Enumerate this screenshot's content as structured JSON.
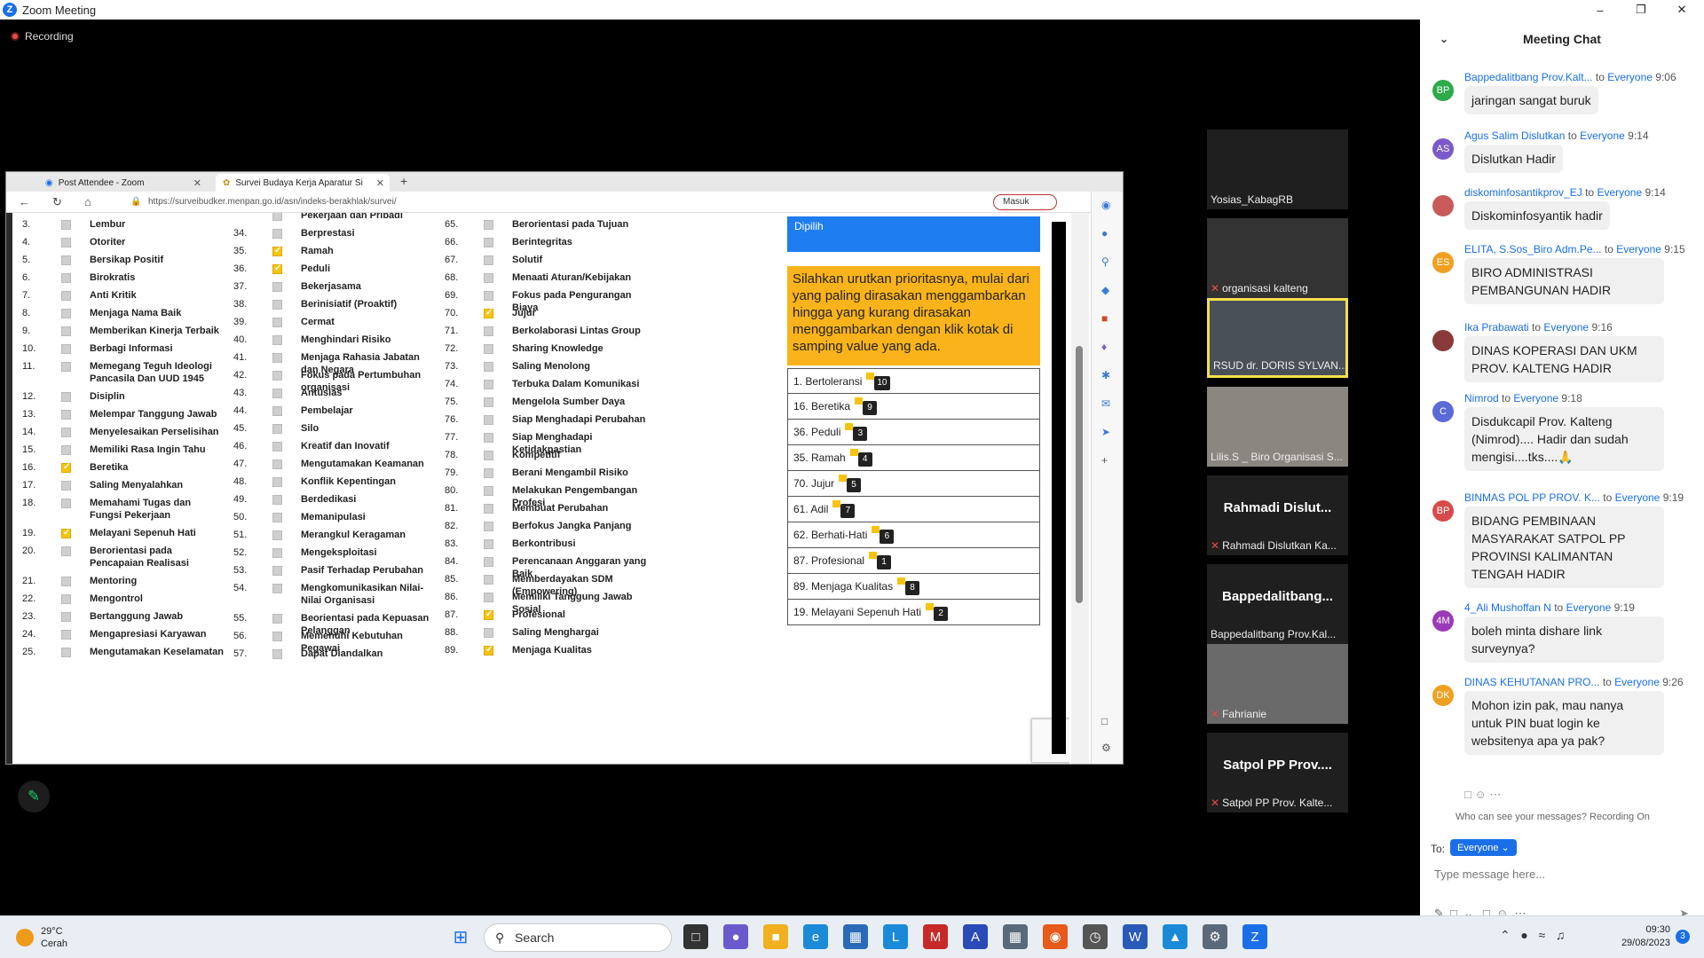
{
  "window": {
    "title": "Zoom Meeting"
  },
  "recording": "Recording",
  "browser": {
    "tabs": [
      {
        "label": "Post Attendee - Zoom"
      },
      {
        "label": "Survei Budaya Kerja Aparatur Si"
      }
    ],
    "url": "https://surveibudker.menpan.go.id/asn/indeks-berakhlak/survei/",
    "masuk": "Masuk"
  },
  "survey": {
    "col1": [
      {
        "n": "3.",
        "label": "Lembur",
        "checked": false
      },
      {
        "n": "4.",
        "label": "Otoriter",
        "checked": false
      },
      {
        "n": "5.",
        "label": "Bersikap Positif",
        "checked": false
      },
      {
        "n": "6.",
        "label": "Birokratis",
        "checked": false
      },
      {
        "n": "7.",
        "label": "Anti Kritik",
        "checked": false
      },
      {
        "n": "8.",
        "label": "Menjaga Nama Baik",
        "checked": false
      },
      {
        "n": "9.",
        "label": "Memberikan Kinerja Terbaik",
        "checked": false
      },
      {
        "n": "10.",
        "label": "Berbagi Informasi",
        "checked": false
      },
      {
        "n": "11.",
        "label": "Memegang Teguh Ideologi Pancasila Dan UUD 1945",
        "checked": false
      },
      {
        "n": "12.",
        "label": "Disiplin",
        "checked": false
      },
      {
        "n": "13.",
        "label": "Melempar Tanggung Jawab",
        "checked": false
      },
      {
        "n": "14.",
        "label": "Menyelesaikan Perselisihan",
        "checked": false
      },
      {
        "n": "15.",
        "label": "Memiliki Rasa Ingin Tahu",
        "checked": false
      },
      {
        "n": "16.",
        "label": "Beretika",
        "checked": true
      },
      {
        "n": "17.",
        "label": "Saling Menyalahkan",
        "checked": false
      },
      {
        "n": "18.",
        "label": "Memahami Tugas dan Fungsi Pekerjaan",
        "checked": false
      },
      {
        "n": "19.",
        "label": "Melayani Sepenuh Hati",
        "checked": true
      },
      {
        "n": "20.",
        "label": "Berorientasi pada Pencapaian Realisasi",
        "checked": false
      },
      {
        "n": "21.",
        "label": "Mentoring",
        "checked": false
      },
      {
        "n": "22.",
        "label": "Mengontrol",
        "checked": false
      },
      {
        "n": "23.",
        "label": "Bertanggung Jawab",
        "checked": false
      },
      {
        "n": "24.",
        "label": "Mengapresiasi Karyawan",
        "checked": false
      },
      {
        "n": "25.",
        "label": "Mengutamakan Keselamatan",
        "checked": false
      }
    ],
    "col2": [
      {
        "n": "",
        "label": "Pekerjaan dan Pribadi",
        "checked": false
      },
      {
        "n": "34.",
        "label": "Berprestasi",
        "checked": false
      },
      {
        "n": "35.",
        "label": "Ramah",
        "checked": true
      },
      {
        "n": "36.",
        "label": "Peduli",
        "checked": true
      },
      {
        "n": "37.",
        "label": "Bekerjasama",
        "checked": false
      },
      {
        "n": "38.",
        "label": "Berinisiatif (Proaktif)",
        "checked": false
      },
      {
        "n": "39.",
        "label": "Cermat",
        "checked": false
      },
      {
        "n": "40.",
        "label": "Menghindari Risiko",
        "checked": false
      },
      {
        "n": "41.",
        "label": "Menjaga Rahasia Jabatan dan Negara",
        "checked": false
      },
      {
        "n": "42.",
        "label": "Fokus pada Pertumbuhan organisasi",
        "checked": false
      },
      {
        "n": "43.",
        "label": "Antusias",
        "checked": false
      },
      {
        "n": "44.",
        "label": "Pembelajar",
        "checked": false
      },
      {
        "n": "45.",
        "label": "Silo",
        "checked": false
      },
      {
        "n": "46.",
        "label": "Kreatif dan Inovatif",
        "checked": false
      },
      {
        "n": "47.",
        "label": "Mengutamakan Keamanan",
        "checked": false
      },
      {
        "n": "48.",
        "label": "Konflik Kepentingan",
        "checked": false
      },
      {
        "n": "49.",
        "label": "Berdedikasi",
        "checked": false
      },
      {
        "n": "50.",
        "label": "Memanipulasi",
        "checked": false
      },
      {
        "n": "51.",
        "label": "Merangkul Keragaman",
        "checked": false
      },
      {
        "n": "52.",
        "label": "Mengeksploitasi",
        "checked": false
      },
      {
        "n": "53.",
        "label": "Pasif Terhadap Perubahan",
        "checked": false
      },
      {
        "n": "54.",
        "label": "Mengkomunikasikan Nilai-Nilai Organisasi",
        "checked": false
      },
      {
        "n": "55.",
        "label": "Beorientasi pada Kepuasan Pelanggan",
        "checked": false
      },
      {
        "n": "56.",
        "label": "Memenuhi Kebutuhan Pegawai",
        "checked": false
      },
      {
        "n": "57.",
        "label": "Dapat Diandalkan",
        "checked": false
      }
    ],
    "col3": [
      {
        "n": "65.",
        "label": "Berorientasi pada Tujuan",
        "checked": false
      },
      {
        "n": "66.",
        "label": "Berintegritas",
        "checked": false
      },
      {
        "n": "67.",
        "label": "Solutif",
        "checked": false
      },
      {
        "n": "68.",
        "label": "Menaati Aturan/Kebijakan",
        "checked": false
      },
      {
        "n": "69.",
        "label": "Fokus pada Pengurangan Biaya",
        "checked": false
      },
      {
        "n": "70.",
        "label": "Jujur",
        "checked": true
      },
      {
        "n": "71.",
        "label": "Berkolaborasi Lintas Group",
        "checked": false
      },
      {
        "n": "72.",
        "label": "Sharing Knowledge",
        "checked": false
      },
      {
        "n": "73.",
        "label": "Saling Menolong",
        "checked": false
      },
      {
        "n": "74.",
        "label": "Terbuka Dalam Komunikasi",
        "checked": false
      },
      {
        "n": "75.",
        "label": "Mengelola Sumber Daya",
        "checked": false
      },
      {
        "n": "76.",
        "label": "Siap Menghadapi Perubahan",
        "checked": false
      },
      {
        "n": "77.",
        "label": "Siap Menghadapi Ketidakpastian",
        "checked": false
      },
      {
        "n": "78.",
        "label": "Kompetitif",
        "checked": false
      },
      {
        "n": "79.",
        "label": "Berani Mengambil Risiko",
        "checked": false
      },
      {
        "n": "80.",
        "label": "Melakukan Pengembangan Profesi",
        "checked": false
      },
      {
        "n": "81.",
        "label": "Membuat Perubahan",
        "checked": false
      },
      {
        "n": "82.",
        "label": "Berfokus Jangka Panjang",
        "checked": false
      },
      {
        "n": "83.",
        "label": "Berkontribusi",
        "checked": false
      },
      {
        "n": "84.",
        "label": "Perencanaan Anggaran yang Baik",
        "checked": false
      },
      {
        "n": "85.",
        "label": "Memberdayakan SDM (Empowering)",
        "checked": false
      },
      {
        "n": "86.",
        "label": "Memiliki Tanggung Jawab Sosial",
        "checked": false
      },
      {
        "n": "87.",
        "label": "Profesional",
        "checked": true
      },
      {
        "n": "88.",
        "label": "Saling Menghargai",
        "checked": false
      },
      {
        "n": "89.",
        "label": "Menjaga Kualitas",
        "checked": true
      }
    ],
    "dipilih": "Dipilih",
    "instruction": "Silahkan urutkan prioritasnya, mulai dari yang paling dirasakan menggambarkan hingga yang kurang dirasakan menggambarkan dengan klik kotak di samping value yang ada.",
    "ranked": [
      {
        "label": "1. Bertoleransi",
        "rank": "10"
      },
      {
        "label": "16. Beretika",
        "rank": "9"
      },
      {
        "label": "36. Peduli",
        "rank": "3"
      },
      {
        "label": "35. Ramah",
        "rank": "4"
      },
      {
        "label": "70. Jujur",
        "rank": "5"
      },
      {
        "label": "61. Adil",
        "rank": "7"
      },
      {
        "label": "62. Berhati-Hati",
        "rank": "6"
      },
      {
        "label": "87. Profesional",
        "rank": "1"
      },
      {
        "label": "89. Menjaga Kualitas",
        "rank": "8"
      },
      {
        "label": "19. Melayani Sepenuh Hati",
        "rank": "2"
      }
    ]
  },
  "participants": [
    {
      "name": "Yosias_KabagRB",
      "muted": false,
      "big": ""
    },
    {
      "name": "organisasi kalteng",
      "muted": true,
      "big": ""
    },
    {
      "name": "RSUD dr. DORIS SYLVAN...",
      "muted": false,
      "big": ""
    },
    {
      "name": "Lilis.S _ Biro Organisasi S...",
      "muted": false,
      "big": ""
    },
    {
      "name": "Rahmadi Dislutkan Ka...",
      "muted": true,
      "big": "Rahmadi  Dislut..."
    },
    {
      "name": "Bappedalitbang Prov.Kal...",
      "muted": false,
      "big": "Bappedalitbang..."
    },
    {
      "name": "Fahrianie",
      "muted": true,
      "big": ""
    },
    {
      "name": "Satpol PP Prov. Kalte...",
      "muted": true,
      "big": "Satpol PP Prov...."
    }
  ],
  "chat": {
    "title": "Meeting Chat",
    "messages": [
      {
        "initials": "BP",
        "color": "#2eaa4a",
        "from": "Bappedalitbang Prov.Kalt...",
        "to": "to",
        "target": "Everyone",
        "time": "9:06",
        "text": "jaringan sangat buruk"
      },
      {
        "initials": "AS",
        "color": "#7a5ac8",
        "from": "Agus Salim Dislutkan",
        "to": "to",
        "target": "Everyone",
        "time": "9:14",
        "text": "Dislutkan Hadir"
      },
      {
        "initials": "",
        "color": "#c85a5a",
        "from": "diskominfosantikprov_EJ",
        "to": "to",
        "target": "Everyone",
        "time": "9:14",
        "text": "Diskominfosyantik hadir"
      },
      {
        "initials": "ES",
        "color": "#f0a020",
        "from": "ELITA, S.Sos_Biro Adm.Pe...",
        "to": "to",
        "target": "Everyone",
        "time": "9:15",
        "text": "BIRO ADMINISTRASI PEMBANGUNAN  HADIR"
      },
      {
        "initials": "",
        "color": "#8a3a3a",
        "from": "Ika Prabawati",
        "to": "to",
        "target": "Everyone",
        "time": "9:16",
        "text": "DINAS KOPERASI DAN UKM PROV. KALTENG HADIR"
      },
      {
        "initials": "C",
        "color": "#5a6ad8",
        "from": "Nimrod",
        "to": "to",
        "target": "Everyone",
        "time": "9:18",
        "text": "Disdukcapil Prov. Kalteng (Nimrod).... Hadir dan sudah mengisi....tks....🙏"
      },
      {
        "initials": "BP",
        "color": "#d84a4a",
        "from": "BINMAS POL PP PROV. K...",
        "to": "to",
        "target": "Everyone",
        "time": "9:19",
        "text": "BIDANG PEMBINAAN MASYARAKAT SATPOL PP PROVINSI KALIMANTAN TENGAH HADIR"
      },
      {
        "initials": "4M",
        "color": "#9a3ab8",
        "from": "4_Ali Mushoffan N",
        "to": "to",
        "target": "Everyone",
        "time": "9:19",
        "text": "boleh minta dishare link surveynya?"
      },
      {
        "initials": "DK",
        "color": "#f0a020",
        "from": "DINAS KEHUTANAN PRO...",
        "to": "to",
        "target": "Everyone",
        "time": "9:26",
        "text": "Mohon izin pak, mau nanya untuk PIN buat login ke websitenya apa ya pak?"
      }
    ],
    "who_can_see": "Who can see your messages? Recording On",
    "to_label": "To:",
    "to_value": "Everyone",
    "placeholder": "Type message here..."
  },
  "taskbar": {
    "temp": "29°C",
    "weather": "Cerah",
    "search": "Search",
    "time": "09:30",
    "date": "29/08/2023",
    "notifications": "3"
  }
}
